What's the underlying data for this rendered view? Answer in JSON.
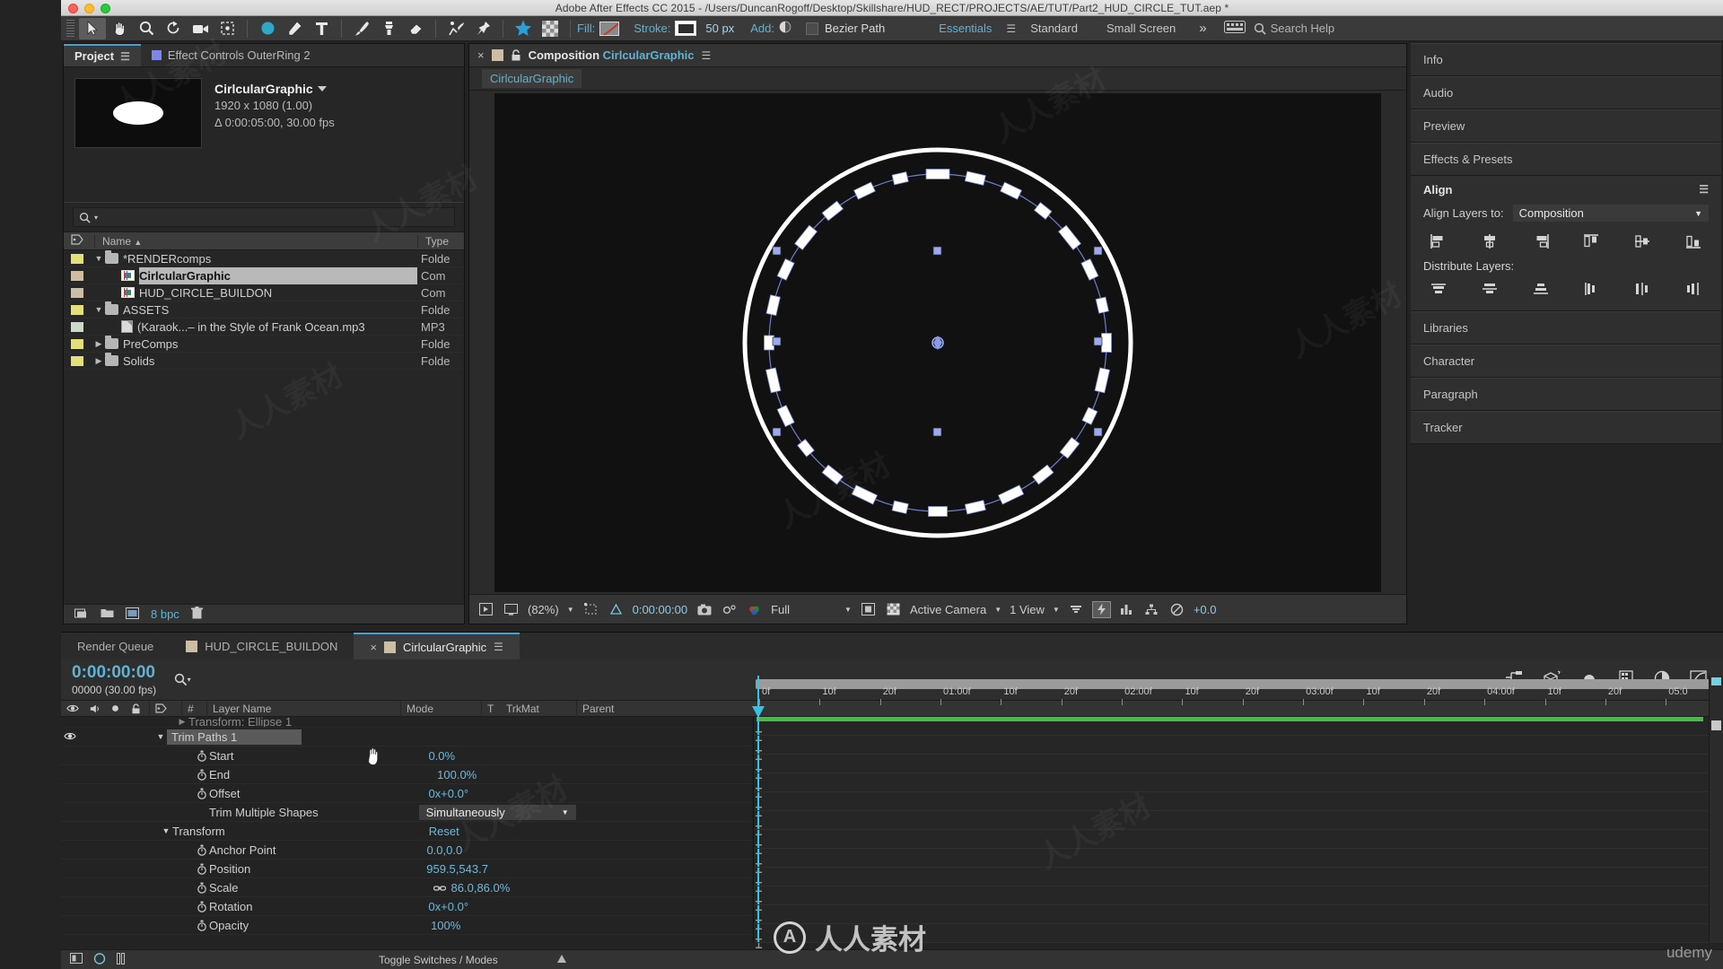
{
  "window": {
    "title": "Adobe After Effects CC 2015 - /Users/DuncanRogoff/Desktop/Skillshare/HUD_RECT/PROJECTS/AE/TUT/Part2_HUD_CIRCLE_TUT.aep *"
  },
  "toolbar": {
    "fill_label": "Fill:",
    "stroke_label": "Stroke:",
    "stroke_width": "50 px",
    "add_label": "Add:",
    "path_mode": "Bezier Path",
    "workspaces": [
      "Essentials",
      "Standard",
      "Small Screen"
    ],
    "workspace_active": "Essentials",
    "overflow": "»",
    "search_help": "Search Help"
  },
  "project_panel": {
    "tabs": [
      {
        "label": "Project",
        "active": true
      },
      {
        "label": "Effect Controls OuterRing 2",
        "active": false
      }
    ],
    "selected_item": {
      "name": "CirlcularGraphic",
      "dimensions": "1920 x 1080 (1.00)",
      "duration": "Δ 0:00:05:00, 30.00 fps"
    },
    "search_placeholder": "",
    "columns": [
      "Name",
      "Type"
    ],
    "items": [
      {
        "name": "*RENDERcomps",
        "type": "Folde",
        "kind": "folder",
        "depth": 0,
        "twirl": "down",
        "color": "#e3e07a",
        "selected": false
      },
      {
        "name": "CirlcularGraphic",
        "type": "Com",
        "kind": "comp",
        "depth": 1,
        "twirl": "",
        "color": "#cdbda4",
        "selected": true
      },
      {
        "name": "HUD_CIRCLE_BUILDON",
        "type": "Com",
        "kind": "comp",
        "depth": 1,
        "twirl": "",
        "color": "#cdbda4",
        "selected": false
      },
      {
        "name": "ASSETS",
        "type": "Folde",
        "kind": "folder",
        "depth": 0,
        "twirl": "down",
        "color": "#e3e07a",
        "selected": false
      },
      {
        "name": "(Karaok...– in the Style of Frank Ocean.mp3",
        "type": "MP3",
        "kind": "mp3",
        "depth": 1,
        "twirl": "",
        "color": "#cdd8c8",
        "selected": false
      },
      {
        "name": "PreComps",
        "type": "Folde",
        "kind": "folder",
        "depth": 0,
        "twirl": "right",
        "color": "#e3e07a",
        "selected": false
      },
      {
        "name": "Solids",
        "type": "Folde",
        "kind": "folder",
        "depth": 0,
        "twirl": "right",
        "color": "#e3e07a",
        "selected": false
      }
    ],
    "footer": {
      "bpc": "8 bpc"
    }
  },
  "composition_panel": {
    "tab_label": "Composition",
    "tab_name": "CirlcularGraphic",
    "breadcrumb": "CirlcularGraphic",
    "footer": {
      "zoom": "(82%)",
      "timecode": "0:00:00:00",
      "resolution": "Full",
      "camera": "Active Camera",
      "views": "1 View",
      "exposure": "+0.0"
    }
  },
  "right_dock": {
    "panels_top": [
      "Info",
      "Audio",
      "Preview",
      "Effects & Presets"
    ],
    "align": {
      "title": "Align",
      "align_to_label": "Align Layers to:",
      "align_to_value": "Composition",
      "distribute_label": "Distribute Layers:"
    },
    "panels_bottom": [
      "Libraries",
      "Character",
      "Paragraph",
      "Tracker"
    ]
  },
  "timeline": {
    "tabs": [
      {
        "label": "Render Queue",
        "active": false,
        "chip": false
      },
      {
        "label": "HUD_CIRCLE_BUILDON",
        "active": false,
        "chip": true
      },
      {
        "label": "CirlcularGraphic",
        "active": true,
        "chip": true
      }
    ],
    "current_time": "0:00:00:00",
    "frame_info": "00000 (30.00 fps)",
    "columns": [
      "Layer Name",
      "Mode",
      "T",
      "TrkMat",
      "Parent"
    ],
    "column_hash": "#",
    "properties": [
      {
        "indent": 128,
        "label": "Transform: Ellipse 1",
        "value": "",
        "type": "group",
        "twirl": "right",
        "clipped": true
      },
      {
        "indent": 104,
        "label": "Trim Paths 1",
        "value": "",
        "type": "group",
        "twirl": "down",
        "highlight": true,
        "eye": true
      },
      {
        "indent": 148,
        "label": "Start",
        "value": "0.0%",
        "type": "prop",
        "stopwatch": true
      },
      {
        "indent": 148,
        "label": "End",
        "value": "100.0%",
        "type": "prop",
        "stopwatch": true
      },
      {
        "indent": 148,
        "label": "Offset",
        "value": "0x+0.0°",
        "type": "prop",
        "stopwatch": true
      },
      {
        "indent": 148,
        "label": "Trim Multiple Shapes",
        "value": "Simultaneously",
        "type": "dropdown"
      },
      {
        "indent": 110,
        "label": "Transform",
        "value": "Reset",
        "type": "group",
        "twirl": "down"
      },
      {
        "indent": 148,
        "label": "Anchor Point",
        "value": "0.0,0.0",
        "type": "prop",
        "stopwatch": true
      },
      {
        "indent": 148,
        "label": "Position",
        "value": "959.5,543.7",
        "type": "prop",
        "stopwatch": true
      },
      {
        "indent": 148,
        "label": "Scale",
        "value": "86.0,86.0%",
        "type": "prop",
        "stopwatch": true,
        "link": true
      },
      {
        "indent": 148,
        "label": "Rotation",
        "value": "0x+0.0°",
        "type": "prop",
        "stopwatch": true
      },
      {
        "indent": 148,
        "label": "Opacity",
        "value": "100%",
        "type": "prop",
        "stopwatch": true
      }
    ],
    "ruler_labels": [
      "0f",
      "10f",
      "20f",
      "01:00f",
      "10f",
      "20f",
      "02:00f",
      "10f",
      "20f",
      "03:00f",
      "10f",
      "20f",
      "04:00f",
      "10f",
      "20f",
      "05:0"
    ],
    "footer_label": "Toggle Switches / Modes"
  },
  "watermark": {
    "text": "人人素材",
    "logo_letter": "A",
    "brand": "udemy"
  },
  "colors": {
    "accent_blue": "#5fb3d4",
    "value_blue": "#6cb9dd",
    "panel_bg": "#2e2e2e",
    "label_yellow": "#e3e07a",
    "label_tan": "#cdbda4",
    "playhead": "#35c3e0",
    "work_green": "#3fc03f"
  }
}
